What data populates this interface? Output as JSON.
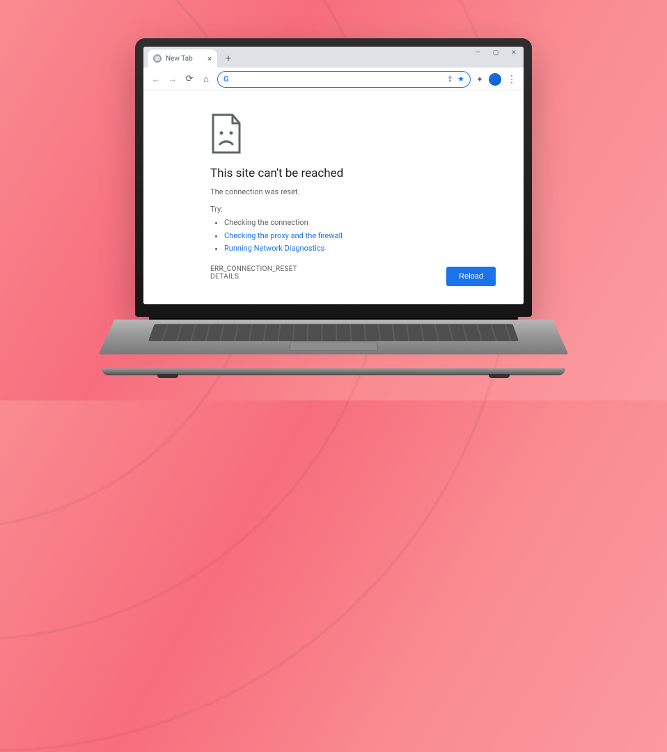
{
  "tab": {
    "title": "New Tab"
  },
  "omnibox": {
    "value": "",
    "placeholder": ""
  },
  "error": {
    "heading": "This site can't be reached",
    "subtext": "The connection was reset.",
    "try_label": "Try:",
    "suggestions": [
      {
        "text": "Checking the connection",
        "link": false
      },
      {
        "text": "Checking the proxy and the firewall",
        "link": true
      },
      {
        "text": "Running Network Diagnostics",
        "link": true
      }
    ],
    "code": "ERR_CONNECTION_RESET",
    "details_label": "DETAILS",
    "reload_label": "Reload"
  }
}
